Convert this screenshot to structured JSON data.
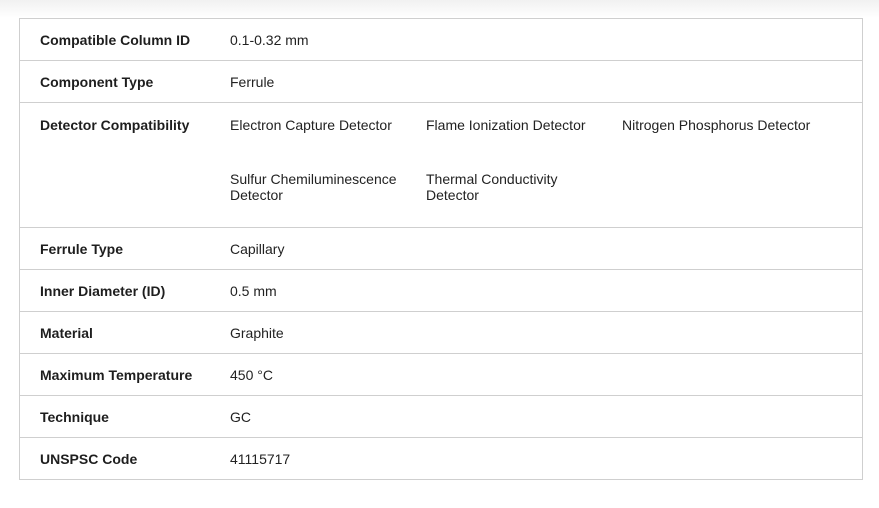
{
  "specs": {
    "rows": [
      {
        "label": "Compatible Column ID",
        "value": "0.1-0.32 mm"
      },
      {
        "label": "Component Type",
        "value": "Ferrule"
      },
      {
        "label": "Detector Compatibility",
        "values": [
          "Electron Capture Detector",
          "Flame Ionization Detector",
          "Nitrogen Phosphorus Detector",
          "Sulfur Chemiluminescence Detector",
          "Thermal Conductivity Detector"
        ]
      },
      {
        "label": "Ferrule Type",
        "value": "Capillary"
      },
      {
        "label": "Inner Diameter (ID)",
        "value": "0.5 mm"
      },
      {
        "label": "Material",
        "value": "Graphite"
      },
      {
        "label": "Maximum Temperature",
        "value": "450 °C"
      },
      {
        "label": "Technique",
        "value": "GC"
      },
      {
        "label": "UNSPSC Code",
        "value": "41115717"
      }
    ]
  }
}
